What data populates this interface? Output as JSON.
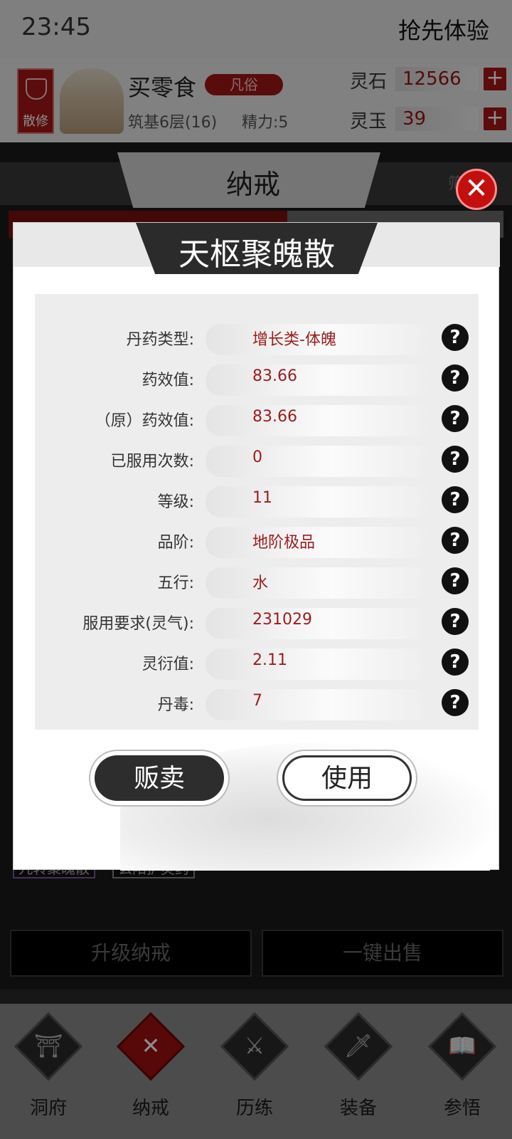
{
  "status_bar": {
    "time": "23:45",
    "early_access": "抢先体验"
  },
  "player": {
    "sect": "散修",
    "name": "买零食",
    "rank": "凡俗",
    "realm": "筑基6层(16)",
    "energy": "精力:5",
    "resources": [
      {
        "label": "灵石",
        "value": "12566",
        "plus": "+"
      },
      {
        "label": "灵玉",
        "value": "39",
        "plus": "+"
      }
    ]
  },
  "bag": {
    "title": "纳戒",
    "filter": "筛",
    "close": "✕",
    "visible_items": [
      "九转聚魄散",
      "玄阳护灵药"
    ],
    "actions": [
      "升级纳戒",
      "一键出售"
    ]
  },
  "modal": {
    "title": "天枢聚魄散",
    "help_glyph": "?",
    "stats": [
      {
        "label": "丹药类型:",
        "value": "增长类-体魄"
      },
      {
        "label": "药效值:",
        "value": "83.66"
      },
      {
        "label": "（原）药效值:",
        "value": "83.66"
      },
      {
        "label": "已服用次数:",
        "value": "0"
      },
      {
        "label": "等级:",
        "value": "11"
      },
      {
        "label": "品阶:",
        "value": "地阶极品"
      },
      {
        "label": "五行:",
        "value": "水"
      },
      {
        "label": "服用要求(灵气):",
        "value": "231029"
      },
      {
        "label": "灵衍值:",
        "value": "2.11"
      },
      {
        "label": "丹毒:",
        "value": "7"
      }
    ],
    "sell_label": "贩卖",
    "use_label": "使用"
  },
  "nav": {
    "items": [
      {
        "label": "洞府",
        "icon": "gate-icon",
        "glyph": "⛩"
      },
      {
        "label": "纳戒",
        "icon": "ring-icon",
        "glyph": "✕"
      },
      {
        "label": "历练",
        "icon": "crossed-swords-icon",
        "glyph": "⚔"
      },
      {
        "label": "装备",
        "icon": "dagger-icon",
        "glyph": "🗡"
      },
      {
        "label": "参悟",
        "icon": "book-icon",
        "glyph": "📖"
      }
    ],
    "active_index": 1
  },
  "colors": {
    "accent_red": "#a81717",
    "value_red": "#9b1d1d",
    "dark": "#2b2b2b"
  }
}
